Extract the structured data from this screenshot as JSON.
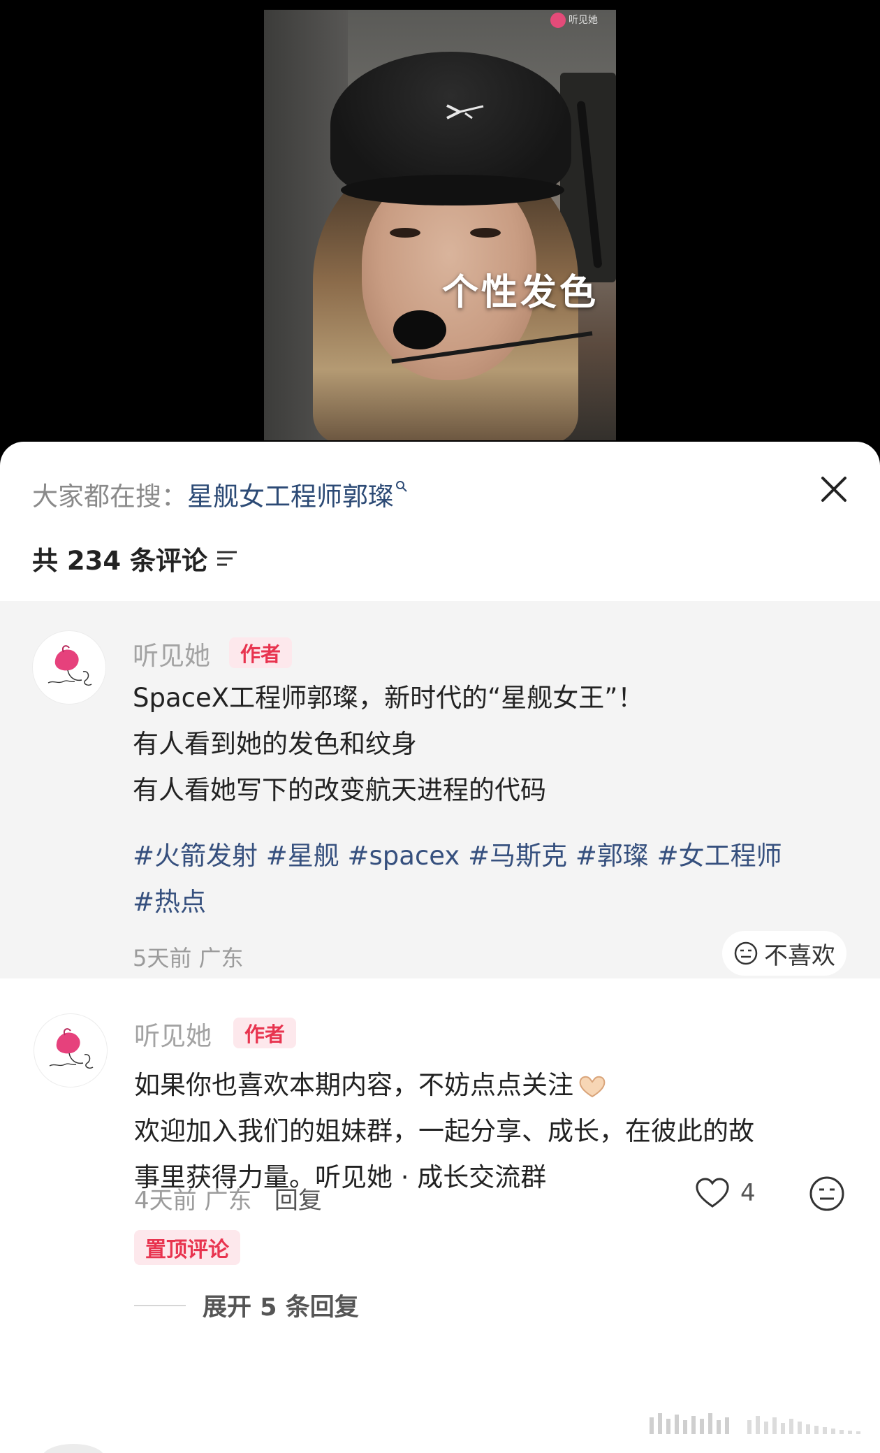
{
  "video": {
    "caption": "个性发色",
    "watermark": "听见她"
  },
  "search": {
    "prefix": "大家都在搜：",
    "term": "星舰女工程师郭璨"
  },
  "comments_header": {
    "label": "共 234 条评论"
  },
  "post": {
    "author": "听见她",
    "author_badge": "作者",
    "lines": [
      "SpaceX工程师郭璨，新时代的“星舰女王”！",
      "有人看到她的发色和纹身",
      "有人看她写下的改变航天进程的代码"
    ],
    "tags_line1": "#火箭发射 #星舰 #spacex #马斯克 #郭璨 #女工程师",
    "tags_line2": "#热点",
    "time": "5天前",
    "location": "广东",
    "dislike_label": "不喜欢"
  },
  "comment": {
    "author": "听见她",
    "author_badge": "作者",
    "line1": "如果你也喜欢本期内容，不妨点点关注",
    "line2": "欢迎加入我们的姐妹群，一起分享、成长，在彼此的故",
    "line3": "事里获得力量。听见她 · 成长交流群",
    "time": "4天前",
    "location": "广东",
    "reply_label": "回复",
    "like_count": "4",
    "pin_badge": "置顶评论",
    "expand_label": "展开 5 条回复"
  },
  "colors": {
    "accent_red": "#e8344f",
    "badge_bg": "#fde8ec",
    "tag_blue": "#36507e",
    "search_blue": "#2c4a75"
  },
  "icons": [
    "search-icon",
    "close-icon",
    "sort-icon",
    "dislike-face-icon",
    "heart-icon",
    "heart-hands-emoji"
  ]
}
